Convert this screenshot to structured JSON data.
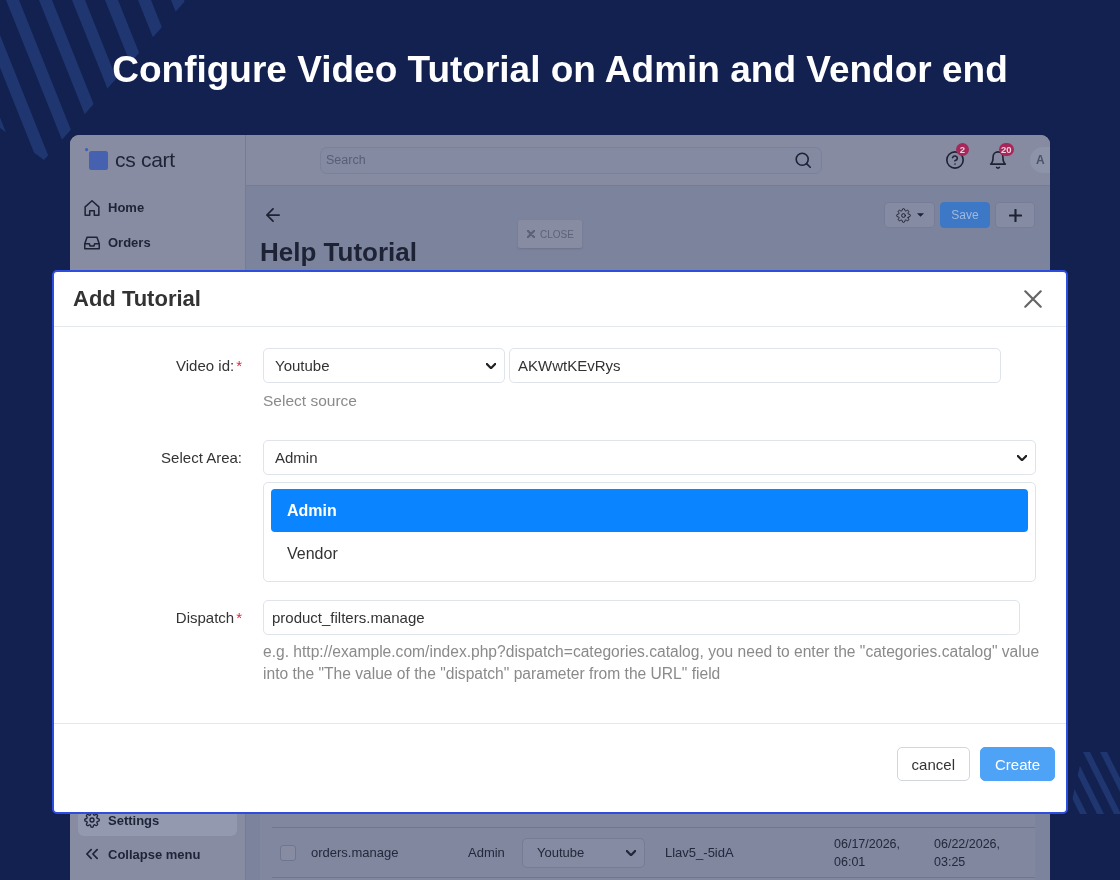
{
  "headline": "Configure Video Tutorial on Admin and Vendor end",
  "app": {
    "logo": "cs cart",
    "search": {
      "placeholder": "Search"
    },
    "header_icons": [
      {
        "kind": "help",
        "badge": "2"
      },
      {
        "kind": "bell",
        "badge": "20"
      }
    ],
    "avatar": "A",
    "sidebar": {
      "items": [
        {
          "kind": "home",
          "label": "Home",
          "selected": false
        },
        {
          "kind": "orders",
          "label": "Orders",
          "selected": false
        }
      ],
      "bottom_items": [
        {
          "kind": "settings",
          "label": "Settings",
          "selected": true
        },
        {
          "kind": "collapse",
          "label": "Collapse menu",
          "selected": false
        }
      ]
    },
    "page": {
      "title": "Help Tutorial",
      "close_tag": "CLOSE",
      "save": "Save"
    },
    "table": {
      "rows": [
        {
          "checked": false,
          "column_2": "orders.manage",
          "column_3": "Admin",
          "column_4": "Youtube",
          "column_5": "Llav5_-5idA",
          "column_6": "06/17/2026, 06:01",
          "column_7": "06/22/2026, 03:25"
        }
      ]
    }
  },
  "modal": {
    "title": "Add Tutorial",
    "fields": [
      {
        "kind": "video",
        "label": "Video id:",
        "required_mark": "*",
        "source": "Youtube",
        "value": "AKWwtKEvRys",
        "hint": "Select source"
      },
      {
        "kind": "area",
        "label": "Select Area:",
        "value": "Admin",
        "options": [
          {
            "label": "Admin",
            "selected": true
          },
          {
            "label": "Vendor",
            "selected": false
          }
        ]
      },
      {
        "kind": "dispatch",
        "label": "Dispatch",
        "required_mark": "*",
        "value": "product_filters.manage",
        "hint": "e.g. http://example.com/index.php?dispatch=categories.catalog, you need to enter the \"categories.catalog\" value into the \"The value of the \"dispatch\" parameter from the URL\" field"
      }
    ],
    "buttons": [
      {
        "kind": "secondary",
        "label": "cancel"
      },
      {
        "kind": "primary",
        "label": "Create"
      }
    ]
  }
}
